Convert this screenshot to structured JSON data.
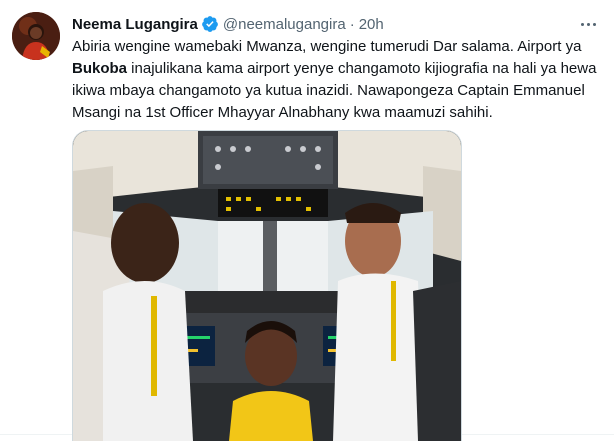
{
  "tweet": {
    "display_name": "Neema Lugangira",
    "handle": "@neemalugangira",
    "separator": "·",
    "time": "20h",
    "text_part1": "Abiria wengine wamebaki Mwanza, wengine tumerudi Dar salama. Airport ya ",
    "text_bold": "Bukoba",
    "text_part2": " inajulikana kama airport yenye changamoto kijiografia na hali ya hewa ikiwa mbaya changamoto ya kutua inazidi. Nawapongeza Captain Emmanuel Msangi na 1st Officer Mhayyar Alnabhany kwa maamuzi sahihi."
  },
  "icons": {
    "verified": "verified-badge-icon",
    "more": "more-options-icon"
  },
  "colors": {
    "verified": "#1d9bf0",
    "secondary_text": "#536471",
    "border": "#cfd9de"
  }
}
